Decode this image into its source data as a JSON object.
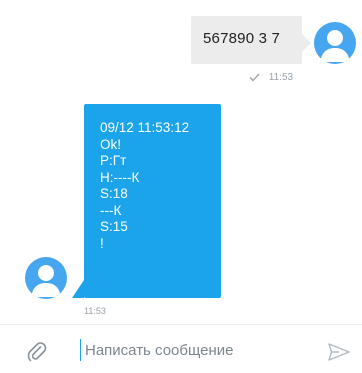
{
  "outgoing": {
    "text": "567890 3 7",
    "time": "11:53",
    "status_icon": "check-icon"
  },
  "incoming": {
    "lines": [
      "09/12 11:53:12",
      "Ok!",
      "P:Гт",
      "H:----К",
      "S:18",
      "---К",
      "S:15",
      "!"
    ],
    "time": "11:53"
  },
  "composer": {
    "placeholder": "Написать сообщение",
    "attach_icon": "paperclip-icon",
    "send_icon": "send-icon"
  },
  "colors": {
    "incoming_bubble": "#1ba4ea",
    "outgoing_bubble": "#ececec",
    "avatar": "#46a6f0",
    "meta_text": "#9aa3ab"
  }
}
